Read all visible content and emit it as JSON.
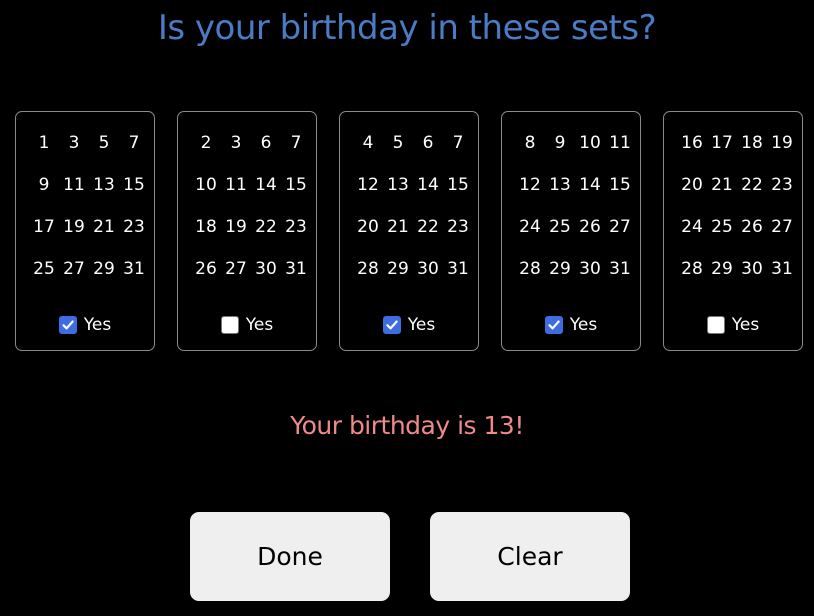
{
  "title": "Is your birthday in these sets?",
  "colors": {
    "title": "#4a7bc4",
    "result": "#ee8a8a",
    "checkbox_checked": "#3d6de0",
    "background": "#000000",
    "button": "#efefef"
  },
  "sets": [
    {
      "numbers": [
        "1",
        "3",
        "5",
        "7",
        "9",
        "11",
        "13",
        "15",
        "17",
        "19",
        "21",
        "23",
        "25",
        "27",
        "29",
        "31"
      ],
      "yes_label": "Yes",
      "checked": true
    },
    {
      "numbers": [
        "2",
        "3",
        "6",
        "7",
        "10",
        "11",
        "14",
        "15",
        "18",
        "19",
        "22",
        "23",
        "26",
        "27",
        "30",
        "31"
      ],
      "yes_label": "Yes",
      "checked": false
    },
    {
      "numbers": [
        "4",
        "5",
        "6",
        "7",
        "12",
        "13",
        "14",
        "15",
        "20",
        "21",
        "22",
        "23",
        "28",
        "29",
        "30",
        "31"
      ],
      "yes_label": "Yes",
      "checked": true
    },
    {
      "numbers": [
        "8",
        "9",
        "10",
        "11",
        "12",
        "13",
        "14",
        "15",
        "24",
        "25",
        "26",
        "27",
        "28",
        "29",
        "30",
        "31"
      ],
      "yes_label": "Yes",
      "checked": true
    },
    {
      "numbers": [
        "16",
        "17",
        "18",
        "19",
        "20",
        "21",
        "22",
        "23",
        "24",
        "25",
        "26",
        "27",
        "28",
        "29",
        "30",
        "31"
      ],
      "yes_label": "Yes",
      "checked": false
    }
  ],
  "result": "Your birthday is 13!",
  "buttons": {
    "done_label": "Done",
    "clear_label": "Clear"
  },
  "icons": {
    "check": "check-icon"
  }
}
